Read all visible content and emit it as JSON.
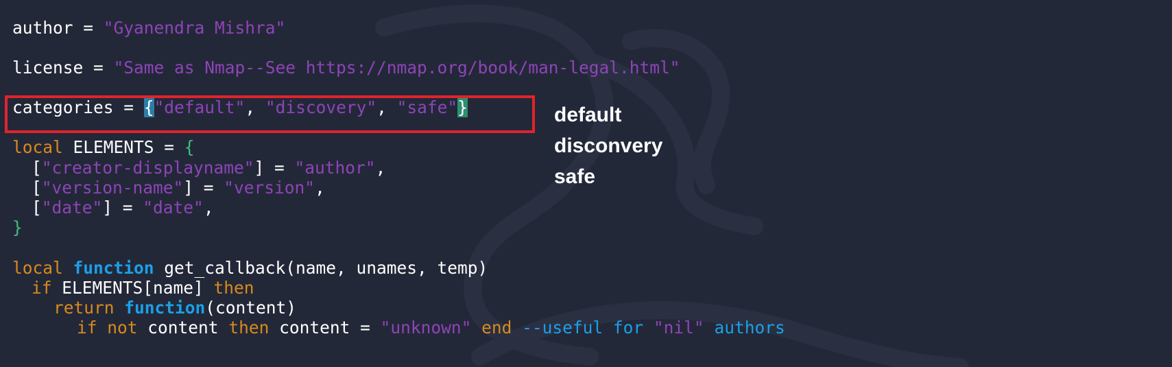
{
  "code": {
    "author_var": "author",
    "author_eq": " = ",
    "author_value": "\"Gyanendra Mishra\"",
    "license_var": "license",
    "license_eq": " = ",
    "license_value": "\"Same as Nmap--See https://nmap.org/book/man-legal.html\"",
    "categories_var": "categories",
    "categories_eq": " = ",
    "categories_open": "{",
    "cat_default": "\"default\"",
    "cat_sep1": ", ",
    "cat_discovery": "\"discovery\"",
    "cat_sep2": ", ",
    "cat_safe": "\"safe\"",
    "categories_close": "}",
    "local_kw": "local",
    "elements_decl": " ELEMENTS = ",
    "elements_open": "{",
    "el1_open": "[",
    "el1_key": "\"creator-displayname\"",
    "el1_mid": "] = ",
    "el1_val": "\"author\"",
    "el1_end": ",",
    "el2_open": "[",
    "el2_key": "\"version-name\"",
    "el2_mid": "] = ",
    "el2_val": "\"version\"",
    "el2_end": ",",
    "el3_open": "[",
    "el3_key": "\"date\"",
    "el3_mid": "] = ",
    "el3_val": "\"date\"",
    "el3_end": ",",
    "elements_close": "}",
    "local_kw2": "local",
    "function_kw": "function",
    "fn_sig": " get_callback(name, unames, temp)",
    "if_kw": "if",
    "if_cond": " ELEMENTS[name] ",
    "then_kw": "then",
    "return_kw": "return",
    "function_kw2": "function",
    "fn2_args": "(content)",
    "if_kw2": "if",
    "not_kw": "not",
    "content1": " content ",
    "then_kw2": "then",
    "assign": " content = ",
    "unknown_str": "\"unknown\"",
    "end_kw": "end",
    "comment_dashes": "--useful for ",
    "nil_str": "\"nil\"",
    "comment_tail": " authors"
  },
  "annotation": {
    "line1": "default",
    "line2": "disconvery",
    "line3": "safe"
  },
  "colors": {
    "background": "#232838",
    "string": "#8e44b8",
    "keyword": "#d98a1c",
    "function": "#1aa0e8",
    "brace": "#3fbf7a",
    "highlight_box": "#e0242c"
  }
}
